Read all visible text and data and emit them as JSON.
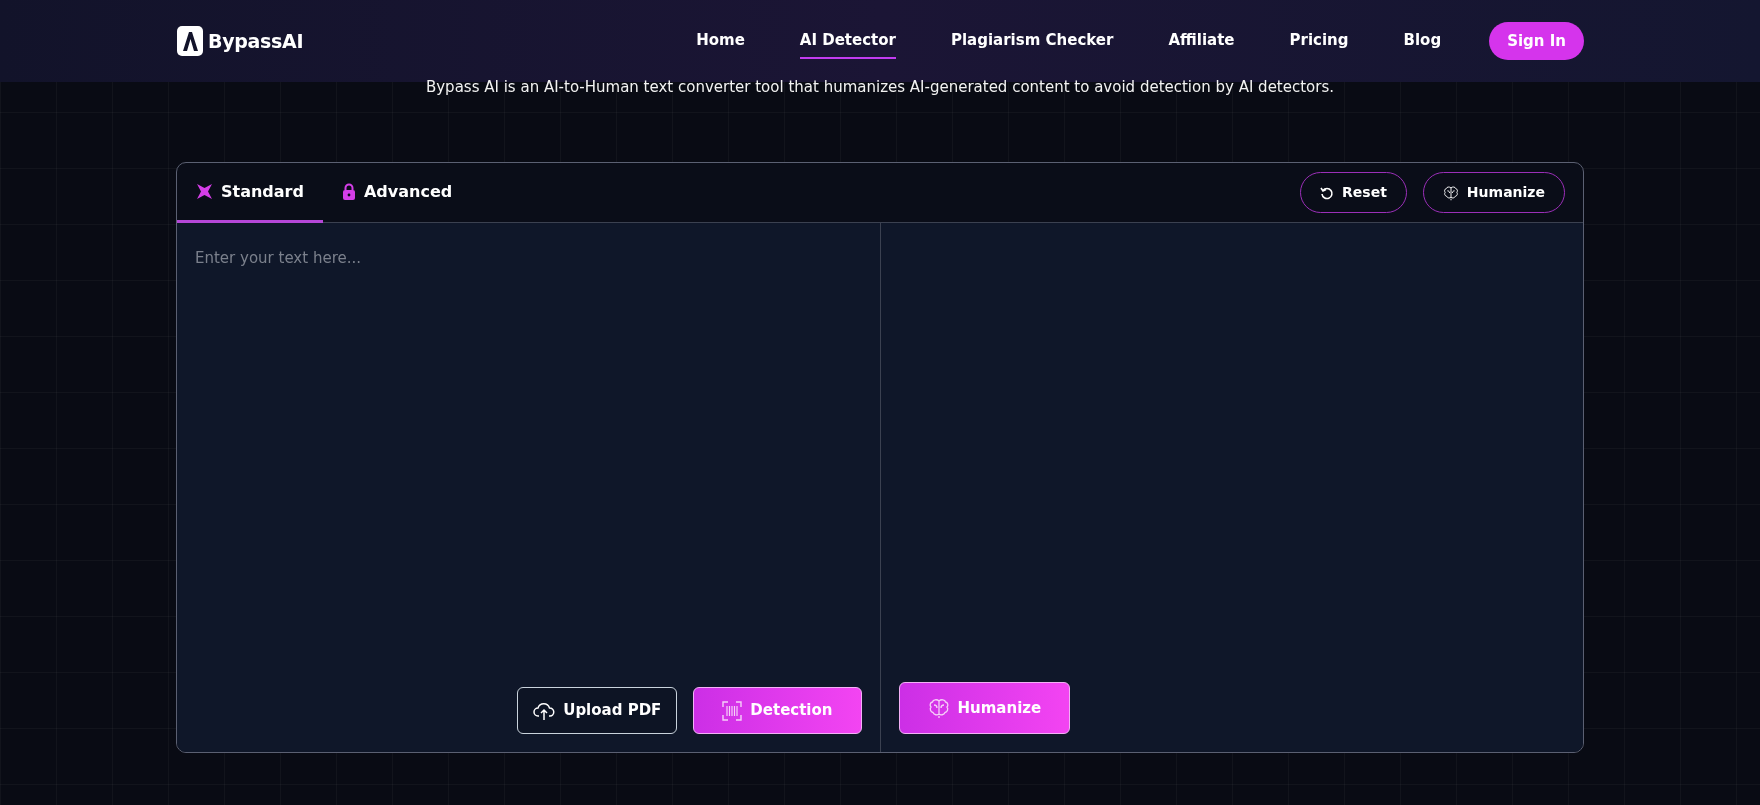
{
  "header": {
    "logo": "BypassAI",
    "nav": [
      {
        "label": "Home",
        "selected": false
      },
      {
        "label": "AI Detector",
        "selected": true
      },
      {
        "label": "Plagiarism Checker",
        "selected": false
      },
      {
        "label": "Affiliate",
        "selected": false
      },
      {
        "label": "Pricing",
        "selected": false
      },
      {
        "label": "Blog",
        "selected": false
      }
    ],
    "sign_in": "Sign In"
  },
  "subtitle": "Bypass AI is an AI-to-Human text converter tool that humanizes AI-generated content to avoid detection by AI detectors.",
  "editor": {
    "tabs": [
      {
        "label": "Standard",
        "selected": true,
        "kind": "standard"
      },
      {
        "label": "Advanced",
        "selected": false,
        "kind": "locked"
      }
    ],
    "reset": "Reset",
    "humanize_top": "Humanize",
    "input": {
      "placeholder": "Enter your text here..."
    },
    "upload": "Upload PDF",
    "detection": "Detection",
    "humanize": "Humanize"
  }
}
